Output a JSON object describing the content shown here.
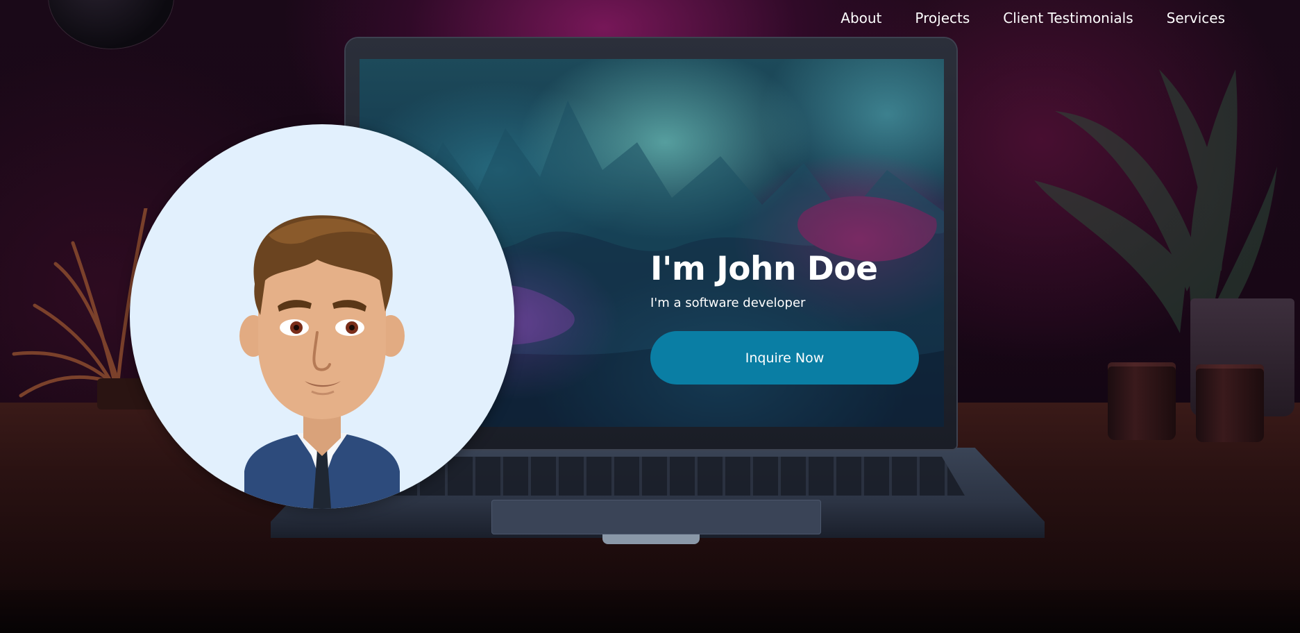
{
  "nav": {
    "items": [
      {
        "label": "About"
      },
      {
        "label": "Projects"
      },
      {
        "label": "Client Testimonials"
      },
      {
        "label": "Services"
      }
    ]
  },
  "hero": {
    "title": "I'm John Doe",
    "subtitle": "I'm a software developer",
    "cta_label": "Inquire Now"
  },
  "colors": {
    "accent": "#0a7ea4",
    "avatar_bg": "#e2f0fd",
    "text": "#ffffff"
  },
  "icons": {
    "avatar": "developer-avatar-illustration"
  }
}
